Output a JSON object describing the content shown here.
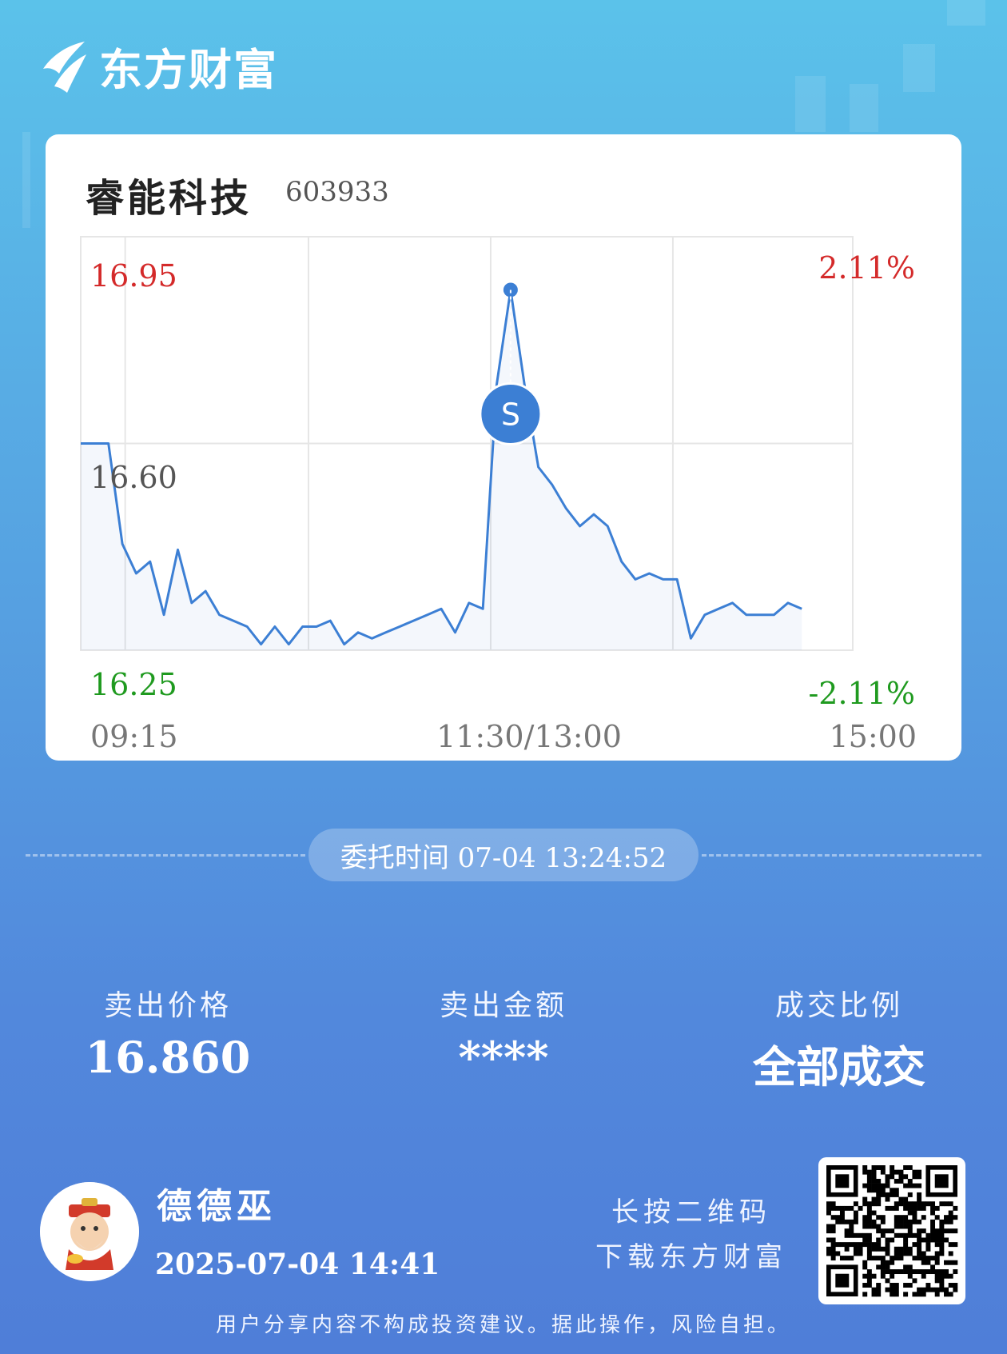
{
  "brand": {
    "name": "东方财富"
  },
  "stock": {
    "name": "睿能科技",
    "code": "603933"
  },
  "chart_data": {
    "type": "line",
    "title": "",
    "y_labels": {
      "top": "16.95",
      "mid": "16.60",
      "bottom": "16.25"
    },
    "pct_labels": {
      "top": "2.11%",
      "bottom": "-2.11%"
    },
    "x_labels": [
      "09:15",
      "11:30/13:00",
      "15:00"
    ],
    "ylim": [
      16.25,
      16.95
    ],
    "prev_close": 16.6,
    "grid": true,
    "x": [
      "09:15",
      "09:25",
      "09:30",
      "09:35",
      "09:40",
      "09:45",
      "09:50",
      "09:55",
      "10:00",
      "10:05",
      "10:10",
      "10:15",
      "10:20",
      "10:25",
      "10:30",
      "10:35",
      "10:40",
      "10:45",
      "10:50",
      "10:55",
      "11:00",
      "11:05",
      "11:10",
      "11:15",
      "11:20",
      "11:25",
      "11:30",
      "13:05",
      "13:10",
      "13:15",
      "13:20",
      "13:22",
      "13:24",
      "13:26",
      "13:30",
      "13:35",
      "13:40",
      "13:45",
      "13:50",
      "13:55",
      "14:00",
      "14:05",
      "14:10",
      "14:15",
      "14:20",
      "14:25",
      "14:30",
      "14:35",
      "14:40",
      "14:45",
      "14:50",
      "14:55",
      "15:00"
    ],
    "values": [
      16.6,
      16.6,
      16.6,
      16.43,
      16.38,
      16.4,
      16.31,
      16.42,
      16.33,
      16.35,
      16.31,
      16.3,
      16.29,
      16.26,
      16.29,
      16.26,
      16.29,
      16.29,
      16.3,
      16.26,
      16.28,
      16.27,
      16.28,
      16.29,
      16.3,
      16.31,
      16.32,
      16.28,
      16.33,
      16.32,
      16.7,
      16.86,
      16.7,
      16.56,
      16.53,
      16.49,
      16.46,
      16.48,
      16.46,
      16.4,
      16.37,
      16.38,
      16.37,
      16.37,
      16.27,
      16.31,
      16.32,
      16.33,
      16.31,
      16.31,
      16.31,
      16.33,
      16.32
    ],
    "markers": [
      {
        "label": "S",
        "price": 16.86
      }
    ]
  },
  "order": {
    "time_label": "委托时间 07-04 13:24:52"
  },
  "stats": [
    {
      "label": "卖出价格",
      "value": "16.860"
    },
    {
      "label": "卖出金额",
      "value": "****"
    },
    {
      "label": "成交比例",
      "value": "全部成交"
    }
  ],
  "user": {
    "name": "德德巫",
    "time": "2025-07-04 14:41"
  },
  "hint": {
    "line1": "长按二维码",
    "line2": "下载东方财富"
  },
  "disclaimer": "用户分享内容不构成投资建议。据此操作，风险自担。",
  "colors": {
    "up": "#d42a2a",
    "down": "#1f9a1f",
    "line": "#3c7fd4"
  }
}
